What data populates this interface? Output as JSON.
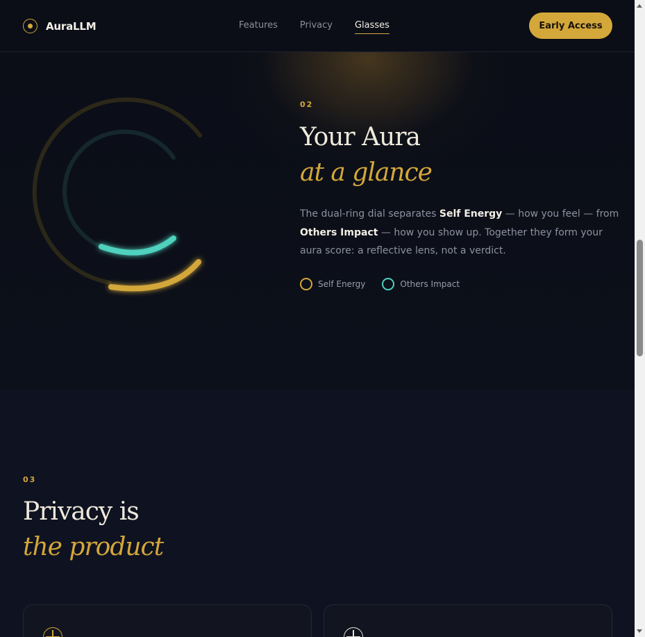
{
  "brand": {
    "name": "AuraLLM"
  },
  "nav": {
    "items": [
      "Features",
      "Privacy",
      "Glasses"
    ],
    "active": "Glasses"
  },
  "cta": {
    "label": "Early Access"
  },
  "dial_section": {
    "number": "02",
    "title_line1": "Your Aura",
    "title_line2": "at a glance",
    "body": {
      "p1": "The dual-ring dial separates ",
      "self_energy": "Self Energy",
      "p2": " — how you feel — from ",
      "others_impact": "Others Impact",
      "p3": " — how you show up. Together they form your aura score: a reflective lens, not a verdict."
    },
    "legend": [
      {
        "label": "Self Energy",
        "color": "#d4a73a"
      },
      {
        "label": "Others Impact",
        "color": "#4fd1be"
      }
    ]
  },
  "privacy_section": {
    "number": "03",
    "title_line1": "Privacy is",
    "title_line2": "the product"
  },
  "colors": {
    "accent": "#d4a73a",
    "teal": "#4fd1be",
    "background": "#0b0e17"
  }
}
